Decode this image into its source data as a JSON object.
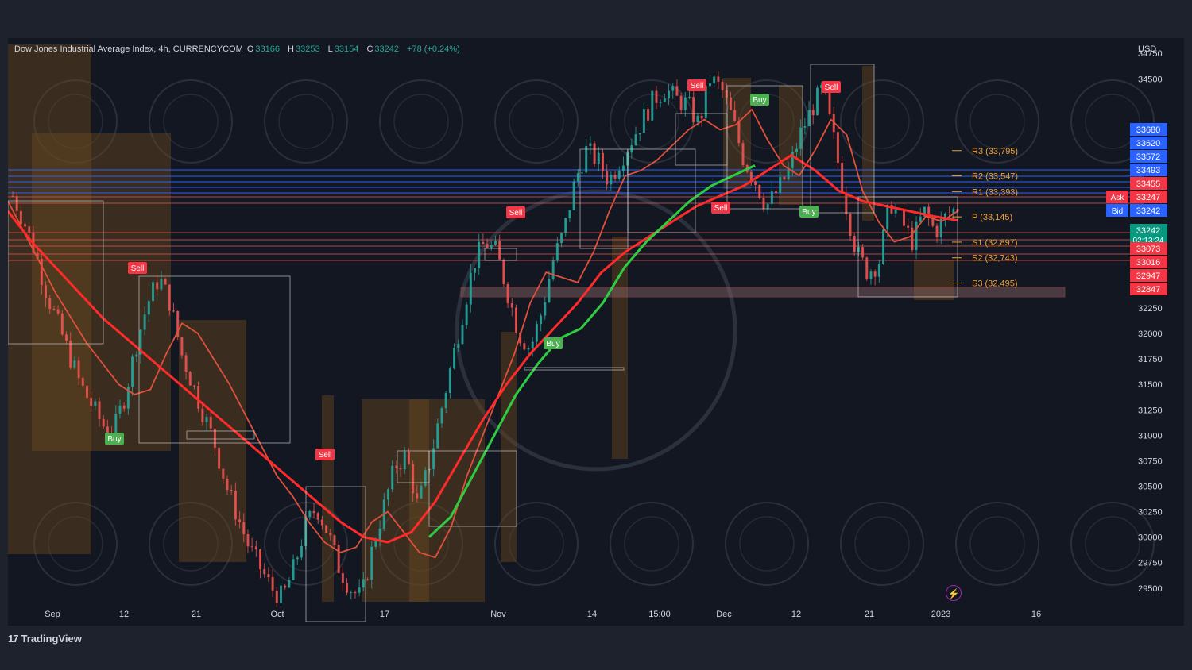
{
  "header": {
    "symbol_text": "Dow Jones Industrial Average Index, 4h, CURRENCYCOM",
    "o_label": "O",
    "o_value": "33166",
    "h_label": "H",
    "h_value": "33253",
    "l_label": "L",
    "l_value": "33154",
    "c_label": "C",
    "c_value": "33242",
    "change": "+78 (+0.24%)"
  },
  "currency": "USD",
  "branding": {
    "name": "TradingView",
    "logo": "17"
  },
  "icons": {
    "alert": "lightning-bolt-icon",
    "logo": "tradingview-logo-icon"
  },
  "colors": {
    "background": "#131722",
    "up": "#26a69a",
    "down": "#ef5350",
    "ribbon_green": "#2ecc40",
    "ribbon_red": "#ff2a2a",
    "pivot_label": "#f0a030",
    "price_blue": "#2962ff",
    "price_green": "#089981"
  },
  "chart_data": {
    "type": "line",
    "title": "Dow Jones Industrial Average Index, 4h, CURRENCYCOM",
    "ylim": [
      29350,
      34900
    ],
    "grid": false,
    "x_ticks": [
      "Sep",
      "12",
      "21",
      "Oct",
      "17",
      "Nov",
      "14",
      "15:00",
      "Dec",
      "12",
      "21",
      "2023",
      "16"
    ],
    "y_ticks": [
      34750,
      34500,
      32250,
      32000,
      31750,
      31500,
      31250,
      31000,
      30750,
      30500,
      30250,
      30000,
      29750,
      29500
    ],
    "series": [
      {
        "values": [
          33350,
          33100,
          32800,
          32400,
          32100,
          31800,
          31500,
          31300,
          31100,
          31050,
          31400,
          31900,
          32300,
          32550,
          32300,
          31800,
          31500,
          31200,
          30900,
          30500,
          30200,
          29900,
          29700,
          29500,
          29400,
          29700,
          30100,
          30300,
          30050,
          29700,
          29500,
          29400,
          29900,
          30300,
          30700,
          30800,
          30300,
          30700,
          31200,
          31700,
          32200,
          32700,
          32900,
          32800,
          32400,
          32000,
          31850,
          32200,
          32700,
          33000,
          33500,
          33800,
          33700,
          33500,
          33700,
          33900,
          34100,
          34300,
          34400,
          34300,
          34250,
          34050,
          34500,
          34400,
          34100,
          33700,
          33500,
          33250,
          33400,
          33600,
          33950,
          34200,
          34400,
          33900,
          33300,
          32800,
          32600,
          32700,
          33300,
          33100,
          32900,
          33200,
          33000,
          33150,
          33242
        ]
      },
      {
        "values": [
          33300,
          33000,
          32700,
          32400,
          32150,
          31900,
          31700,
          31500,
          31400,
          31450,
          31800,
          32100,
          32000,
          31750,
          31500,
          31200,
          30900,
          30600,
          30400,
          30150,
          29950,
          29850,
          29900,
          30150,
          30250,
          30050,
          29850,
          29800,
          30100,
          30600,
          31000,
          31400,
          31800,
          32300,
          32600,
          32550,
          32500,
          32800,
          33200,
          33550,
          33600,
          33700,
          33850,
          34000,
          34100,
          34000,
          34050,
          34200,
          33900,
          33650,
          33550,
          33800,
          34100,
          33950,
          33400,
          33100,
          32900,
          32950,
          33150,
          33100,
          33200
        ]
      },
      {
        "values": [
          33200,
          32900,
          32650,
          32400,
          32150,
          31950,
          31750,
          31550,
          31350,
          31150,
          30950,
          30750,
          30550,
          30350,
          30150,
          30000,
          29950,
          30050,
          30350,
          30750,
          31150,
          31500,
          31800,
          32050,
          32300,
          32600,
          32800,
          32950,
          33100,
          33250,
          33350,
          33450,
          33600,
          33750,
          33600,
          33400,
          33300,
          33250,
          33200,
          33150,
          33110
        ]
      },
      {
        "values": [
          30000,
          30200,
          30600,
          31000,
          31400,
          31700,
          31950,
          32050,
          32300,
          32650,
          32900,
          33100,
          33300,
          33450,
          33550,
          33650
        ]
      }
    ],
    "pivot_levels": [
      {
        "label": "R3 (33,795)",
        "value": 33795
      },
      {
        "label": "R2 (33,547)",
        "value": 33547
      },
      {
        "label": "R1 (33,393)",
        "value": 33393
      },
      {
        "label": "P (33,145)",
        "value": 33145
      },
      {
        "label": "S1 (32,897)",
        "value": 32897
      },
      {
        "label": "S2 (32,743)",
        "value": 32743
      },
      {
        "label": "S3 (32,495)",
        "value": 32495
      }
    ],
    "price_scale_labels": [
      {
        "text": "33680",
        "kind": "blue"
      },
      {
        "text": "33620",
        "kind": "blue"
      },
      {
        "text": "33572",
        "kind": "blue"
      },
      {
        "text": "33493",
        "kind": "blue"
      },
      {
        "text": "33455",
        "kind": "red"
      },
      {
        "text": "33247",
        "kind": "red",
        "tag": "Ask"
      },
      {
        "text": "33242",
        "kind": "blue",
        "tag": "Bid"
      },
      {
        "text": "33242",
        "kind": "green",
        "sub": "02:13:24"
      },
      {
        "text": "33073",
        "kind": "red"
      },
      {
        "text": "33016",
        "kind": "red"
      },
      {
        "text": "32947",
        "kind": "red"
      },
      {
        "text": "32847",
        "kind": "red"
      }
    ],
    "signals": [
      {
        "text": "Sell",
        "type": "sell"
      },
      {
        "text": "Buy",
        "type": "buy"
      },
      {
        "text": "Sell",
        "type": "sell"
      },
      {
        "text": "Sell",
        "type": "sell"
      },
      {
        "text": "Buy",
        "type": "buy"
      },
      {
        "text": "Sell",
        "type": "sell"
      },
      {
        "text": "Buy",
        "type": "buy"
      },
      {
        "text": "Sell",
        "type": "sell"
      },
      {
        "text": "Sell",
        "type": "sell"
      },
      {
        "text": "Buy",
        "type": "buy"
      }
    ]
  }
}
